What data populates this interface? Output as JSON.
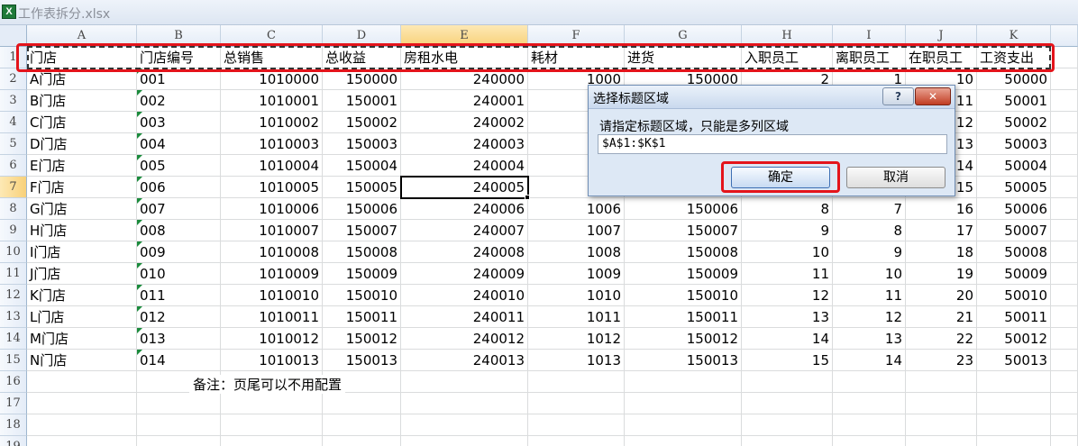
{
  "window": {
    "title": "工作表拆分.xlsx",
    "app_icon": "excel-icon"
  },
  "columns": [
    "A",
    "B",
    "C",
    "D",
    "E",
    "F",
    "G",
    "H",
    "I",
    "J",
    "K"
  ],
  "selected_column": "E",
  "selected_row": "7",
  "rows": [
    {
      "num": "1",
      "cells": [
        "门店",
        "门店编号",
        "总销售",
        "总收益",
        "房租水电",
        "耗材",
        "进货",
        "入职员工",
        "离职员工",
        "在职员工",
        "工资支出"
      ]
    },
    {
      "num": "2",
      "cells": [
        "A门店",
        "001",
        "1010000",
        "150000",
        "240000",
        "1000",
        "150000",
        "2",
        "1",
        "10",
        "50000"
      ]
    },
    {
      "num": "3",
      "cells": [
        "B门店",
        "002",
        "1010001",
        "150001",
        "240001",
        "",
        "",
        "",
        "",
        "11",
        "50001"
      ]
    },
    {
      "num": "4",
      "cells": [
        "C门店",
        "003",
        "1010002",
        "150002",
        "240002",
        "",
        "",
        "",
        "",
        "12",
        "50002"
      ]
    },
    {
      "num": "5",
      "cells": [
        "D门店",
        "004",
        "1010003",
        "150003",
        "240003",
        "",
        "",
        "",
        "",
        "13",
        "50003"
      ]
    },
    {
      "num": "6",
      "cells": [
        "E门店",
        "005",
        "1010004",
        "150004",
        "240004",
        "",
        "",
        "",
        "",
        "14",
        "50004"
      ]
    },
    {
      "num": "7",
      "cells": [
        "F门店",
        "006",
        "1010005",
        "150005",
        "240005",
        "",
        "",
        "",
        "",
        "15",
        "50005"
      ]
    },
    {
      "num": "8",
      "cells": [
        "G门店",
        "007",
        "1010006",
        "150006",
        "240006",
        "1006",
        "150006",
        "8",
        "7",
        "16",
        "50006"
      ]
    },
    {
      "num": "9",
      "cells": [
        "H门店",
        "008",
        "1010007",
        "150007",
        "240007",
        "1007",
        "150007",
        "9",
        "8",
        "17",
        "50007"
      ]
    },
    {
      "num": "10",
      "cells": [
        "I门店",
        "009",
        "1010008",
        "150008",
        "240008",
        "1008",
        "150008",
        "10",
        "9",
        "18",
        "50008"
      ]
    },
    {
      "num": "11",
      "cells": [
        "J门店",
        "010",
        "1010009",
        "150009",
        "240009",
        "1009",
        "150009",
        "11",
        "10",
        "19",
        "50009"
      ]
    },
    {
      "num": "12",
      "cells": [
        "K门店",
        "011",
        "1010010",
        "150010",
        "240010",
        "1010",
        "150010",
        "12",
        "11",
        "20",
        "50010"
      ]
    },
    {
      "num": "13",
      "cells": [
        "L门店",
        "012",
        "1010011",
        "150011",
        "240011",
        "1011",
        "150011",
        "13",
        "12",
        "21",
        "50011"
      ]
    },
    {
      "num": "14",
      "cells": [
        "M门店",
        "013",
        "1010012",
        "150012",
        "240012",
        "1012",
        "150012",
        "14",
        "13",
        "22",
        "50012"
      ]
    },
    {
      "num": "15",
      "cells": [
        "N门店",
        "014",
        "1010013",
        "150013",
        "240013",
        "1013",
        "150013",
        "15",
        "14",
        "23",
        "50013"
      ]
    },
    {
      "num": "16",
      "cells": [
        "",
        "",
        "",
        "",
        "",
        "",
        "",
        "",
        "",
        "",
        ""
      ]
    },
    {
      "num": "17",
      "cells": [
        "",
        "",
        "",
        "",
        "",
        "",
        "",
        "",
        "",
        "",
        ""
      ]
    },
    {
      "num": "18",
      "cells": [
        "",
        "",
        "",
        "",
        "",
        "",
        "",
        "",
        "",
        "",
        ""
      ]
    },
    {
      "num": "19",
      "cells": [
        "",
        "",
        "",
        "",
        "",
        "",
        "",
        "",
        "",
        "",
        ""
      ]
    }
  ],
  "note": "备注：页尾可以不用配置",
  "dialog": {
    "title": "选择标题区域",
    "help_label": "?",
    "close_label": "✕",
    "prompt": "请指定标题区域，只能是多列区域",
    "range_value": "$A$1:$K$1",
    "ok_label": "确定",
    "cancel_label": "取消"
  },
  "colors": {
    "highlight_red": "#e4141b",
    "selected_header": "#f8d17a",
    "text_flag_green": "#1b8b3c"
  }
}
